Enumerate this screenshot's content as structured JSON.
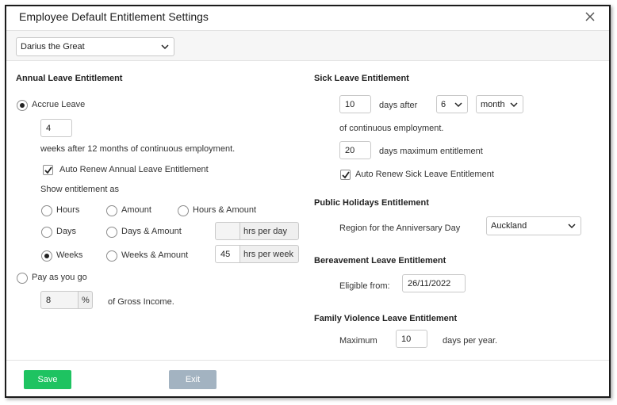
{
  "dialog": {
    "title": "Employee Default Entitlement Settings"
  },
  "employee_select": {
    "value": "Darius the Great"
  },
  "annual": {
    "heading": "Annual Leave Entitlement",
    "accrue_label": "Accrue Leave",
    "weeks_value": "4",
    "weeks_text": "weeks after 12 months of continuous employment.",
    "auto_renew_label": "Auto Renew Annual Leave Entitlement",
    "show_as_label": "Show entitlement as",
    "options": {
      "hours": "Hours",
      "amount": "Amount",
      "hours_amount": "Hours & Amount",
      "days": "Days",
      "days_amount": "Days & Amount",
      "weeks": "Weeks",
      "weeks_amount": "Weeks & Amount"
    },
    "hrs_per_day_value": "",
    "hrs_per_day_label": "hrs per day",
    "hrs_per_week_value": "45",
    "hrs_per_week_label": "hrs per week",
    "pay_as_you_go_label": "Pay as you go",
    "percent_value": "8",
    "percent_symbol": "%",
    "gross_text": "of Gross Income."
  },
  "sick": {
    "heading": "Sick Leave Entitlement",
    "days_value": "10",
    "days_after_text": "days after",
    "months_value": "6",
    "unit_value": "month",
    "continuous_text": "of continuous employment.",
    "max_value": "20",
    "max_text": "days maximum entitlement",
    "auto_renew_label": "Auto Renew Sick Leave Entitlement"
  },
  "public_holidays": {
    "heading": "Public Holidays Entitlement",
    "region_label": "Region for the Anniversary Day",
    "region_value": "Auckland"
  },
  "bereavement": {
    "heading": "Bereavement Leave Entitlement",
    "eligible_label": "Eligible from:",
    "eligible_value": "26/11/2022"
  },
  "family_violence": {
    "heading": "Family Violence Leave Entitlement",
    "maximum_label": "Maximum",
    "maximum_value": "10",
    "per_year_text": "days per year."
  },
  "footer": {
    "save_label": "Save",
    "exit_label": "Exit"
  },
  "colors": {
    "save": "#1ec361",
    "exit": "#a3b3c1",
    "accent": "#222222"
  },
  "icons": [
    "close-icon",
    "chevron-down-icon",
    "checkmark-icon"
  ]
}
